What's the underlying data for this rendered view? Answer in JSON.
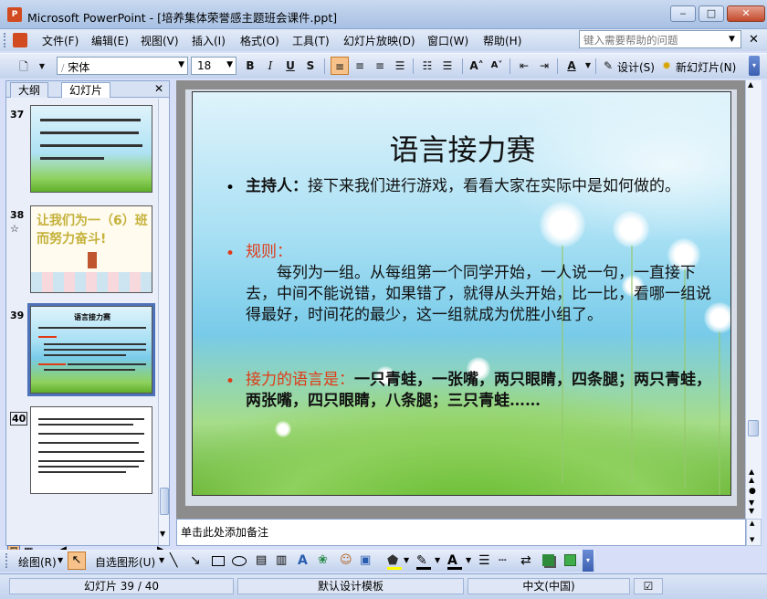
{
  "window": {
    "app_name": "Microsoft PowerPoint",
    "title": "Microsoft PowerPoint - [培养集体荣誉感主题班会课件.ppt]",
    "icon_text": "P"
  },
  "menu": {
    "items": [
      "文件(F)",
      "编辑(E)",
      "视图(V)",
      "插入(I)",
      "格式(O)",
      "工具(T)",
      "幻灯片放映(D)",
      "窗口(W)",
      "帮助(H)"
    ],
    "help_placeholder": "键入需要帮助的问题"
  },
  "toolbar": {
    "font_name": "宋体",
    "font_size": "18",
    "bold": "B",
    "italic": "I",
    "underline": "U",
    "shadow": "S",
    "design_label": "设计(S)",
    "new_slide_label": "新幻灯片(N)"
  },
  "left_pane": {
    "tabs": [
      "大纲",
      "幻灯片"
    ],
    "thumbnails": [
      {
        "number": "37",
        "kind": "text-on-meadow"
      },
      {
        "number": "38",
        "kind": "banner",
        "text": "让我们为一（6）班而努力奋斗!",
        "star": "☆"
      },
      {
        "number": "39",
        "kind": "current",
        "title": "语言接力赛"
      },
      {
        "number": "40",
        "kind": "text-list"
      }
    ]
  },
  "slide": {
    "title": "语言接力赛",
    "bullets": [
      {
        "label": "主持人：",
        "label_color": "black",
        "text": "接下来我们进行游戏，看看大家在实际中是如何做的。"
      },
      {
        "label": "规则：",
        "label_color": "#e03a16",
        "text": "每列为一组。从每组第一个同学开始，一人说一句，一直接下去，中间不能说错，如果错了，就得从头开始，比一比，看哪一组说得最好，时间花的最少，这一组就成为优胜小组了。"
      },
      {
        "label": "接力的语言是：",
        "label_color": "#e03a16",
        "text": "一只青蛙，一张嘴，两只眼睛，四条腿；两只青蛙，两张嘴，四只眼睛，八条腿；三只青蛙……"
      }
    ]
  },
  "notes": {
    "placeholder": "单击此处添加备注"
  },
  "draw_toolbar": {
    "draw_label": "绘图(R)",
    "autoshapes_label": "自选图形(U)"
  },
  "status": {
    "slide_position": "幻灯片 39 / 40",
    "template": "默认设计模板",
    "language": "中文(中国)"
  },
  "colors": {
    "accent": "#4e72b8",
    "slide_red": "#e03a16",
    "chrome": "#c3d3ed"
  }
}
